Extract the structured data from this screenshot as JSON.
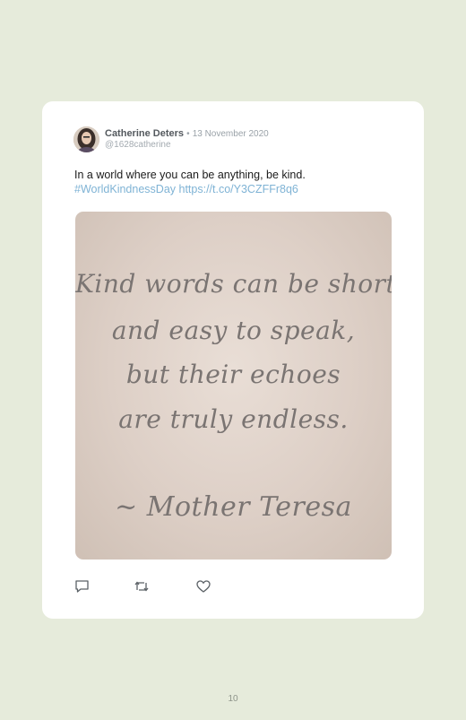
{
  "tweet": {
    "author_name": "Catherine Deters",
    "separator": "•",
    "date": "13 November 2020",
    "handle": "@1628catherine",
    "text_line1": "In a world where you can be anything, be kind.",
    "text_line2": "#WorldKindnessDay https://t.co/Y3CZFFr8q6"
  },
  "media": {
    "quote_lines": [
      "Kind words can be short",
      "and easy to speak,",
      "but their echoes",
      "are truly endless.",
      "~ Mother Teresa"
    ]
  },
  "actions": {
    "icons": [
      "reply-icon",
      "retweet-icon",
      "like-icon"
    ]
  },
  "colors": {
    "background": "#e6ebdb",
    "card": "#ffffff",
    "link": "#7fb3d5"
  },
  "page": {
    "number": "10"
  }
}
